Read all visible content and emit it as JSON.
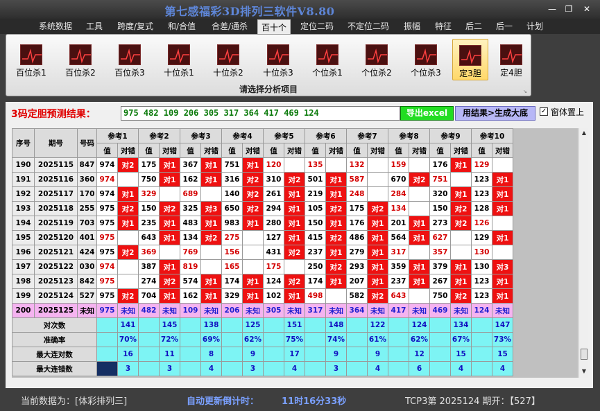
{
  "app": {
    "title": "第七感福彩3D排列三软件V8.80"
  },
  "menu": [
    "系统数据",
    "工具",
    "跨度/复式",
    "和/合值",
    "合差/通杀",
    "百十个",
    "定位二码",
    "不定位二码",
    "振幅",
    "特征",
    "后二",
    "后一",
    "计划"
  ],
  "active_menu": "百十个",
  "ribbon": {
    "buttons": [
      "百位杀1",
      "百位杀2",
      "百位杀3",
      "十位杀1",
      "十位杀2",
      "十位杀3",
      "个位杀1",
      "个位杀2",
      "个位杀3",
      "定3胆",
      "定4胆"
    ],
    "active": "定3胆",
    "caption": "请选择分析项目"
  },
  "result": {
    "label": "3码定胆预测结果：",
    "numbers": "975 482 109 206 305 317 364 417 469 124",
    "excel_label": "导出excel",
    "generate_label": "用结果>生成大底",
    "checkbox_label": "窗体置上",
    "checked": true
  },
  "table": {
    "hdr_seq": "序号",
    "hdr_period": "期号",
    "hdr_code": "号码",
    "refs": [
      "参考1",
      "参考2",
      "参考3",
      "参考4",
      "参考5",
      "参考6",
      "参考7",
      "参考8",
      "参考9",
      "参考10"
    ],
    "sub_val": "值",
    "sub_mark": "对错",
    "rows": [
      {
        "seq": "190",
        "period": "2025115",
        "code": "847",
        "cells": [
          [
            "974",
            "对2"
          ],
          [
            "175",
            "对1"
          ],
          [
            "367",
            "对1"
          ],
          [
            "751",
            "对1"
          ],
          [
            "120",
            ""
          ],
          [
            "135",
            ""
          ],
          [
            "132",
            ""
          ],
          [
            "159",
            ""
          ],
          [
            "176",
            "对1"
          ],
          [
            "129",
            ""
          ]
        ]
      },
      {
        "seq": "191",
        "period": "2025116",
        "code": "360",
        "cells": [
          [
            "974",
            ""
          ],
          [
            "750",
            "对1"
          ],
          [
            "162",
            "对1"
          ],
          [
            "316",
            "对2"
          ],
          [
            "310",
            "对2"
          ],
          [
            "501",
            "对1"
          ],
          [
            "587",
            ""
          ],
          [
            "670",
            "对2"
          ],
          [
            "751",
            ""
          ],
          [
            "123",
            "对1"
          ]
        ]
      },
      {
        "seq": "192",
        "period": "2025117",
        "code": "170",
        "cells": [
          [
            "974",
            "对1"
          ],
          [
            "329",
            ""
          ],
          [
            "689",
            ""
          ],
          [
            "140",
            "对2"
          ],
          [
            "261",
            "对1"
          ],
          [
            "219",
            "对1"
          ],
          [
            "248",
            ""
          ],
          [
            "284",
            ""
          ],
          [
            "320",
            "对1"
          ],
          [
            "123",
            "对1"
          ]
        ]
      },
      {
        "seq": "193",
        "period": "2025118",
        "code": "255",
        "cells": [
          [
            "975",
            "对2"
          ],
          [
            "150",
            "对2"
          ],
          [
            "325",
            "对3"
          ],
          [
            "650",
            "对2"
          ],
          [
            "294",
            "对1"
          ],
          [
            "105",
            "对2"
          ],
          [
            "175",
            "对2"
          ],
          [
            "134",
            ""
          ],
          [
            "150",
            "对2"
          ],
          [
            "128",
            "对1"
          ]
        ]
      },
      {
        "seq": "194",
        "period": "2025119",
        "code": "703",
        "cells": [
          [
            "975",
            "对1"
          ],
          [
            "235",
            "对1"
          ],
          [
            "483",
            "对1"
          ],
          [
            "983",
            "对1"
          ],
          [
            "280",
            "对1"
          ],
          [
            "150",
            "对1"
          ],
          [
            "176",
            "对1"
          ],
          [
            "201",
            "对1"
          ],
          [
            "273",
            "对2"
          ],
          [
            "126",
            ""
          ]
        ]
      },
      {
        "seq": "195",
        "period": "2025120",
        "code": "401",
        "cells": [
          [
            "975",
            ""
          ],
          [
            "643",
            "对1"
          ],
          [
            "134",
            "对2"
          ],
          [
            "275",
            ""
          ],
          [
            "127",
            "对1"
          ],
          [
            "415",
            "对2"
          ],
          [
            "486",
            "对1"
          ],
          [
            "564",
            "对1"
          ],
          [
            "627",
            ""
          ],
          [
            "129",
            "对1"
          ]
        ]
      },
      {
        "seq": "196",
        "period": "2025121",
        "code": "424",
        "cells": [
          [
            "975",
            "对2"
          ],
          [
            "369",
            ""
          ],
          [
            "769",
            ""
          ],
          [
            "156",
            ""
          ],
          [
            "431",
            "对2"
          ],
          [
            "237",
            "对1"
          ],
          [
            "279",
            "对1"
          ],
          [
            "317",
            ""
          ],
          [
            "357",
            ""
          ],
          [
            "130",
            ""
          ]
        ]
      },
      {
        "seq": "197",
        "period": "2025122",
        "code": "030",
        "cells": [
          [
            "974",
            ""
          ],
          [
            "387",
            "对1"
          ],
          [
            "819",
            ""
          ],
          [
            "165",
            ""
          ],
          [
            "175",
            ""
          ],
          [
            "250",
            "对2"
          ],
          [
            "293",
            "对1"
          ],
          [
            "359",
            "对1"
          ],
          [
            "379",
            "对1"
          ],
          [
            "130",
            "对3"
          ]
        ]
      },
      {
        "seq": "198",
        "period": "2025123",
        "code": "842",
        "cells": [
          [
            "975",
            ""
          ],
          [
            "274",
            "对2"
          ],
          [
            "574",
            "对1"
          ],
          [
            "174",
            "对1"
          ],
          [
            "124",
            "对2"
          ],
          [
            "174",
            "对1"
          ],
          [
            "207",
            "对1"
          ],
          [
            "237",
            "对1"
          ],
          [
            "267",
            "对1"
          ],
          [
            "123",
            "对1"
          ]
        ]
      },
      {
        "seq": "199",
        "period": "2025124",
        "code": "527",
        "cells": [
          [
            "975",
            "对2"
          ],
          [
            "704",
            "对1"
          ],
          [
            "162",
            "对1"
          ],
          [
            "329",
            "对1"
          ],
          [
            "102",
            "对1"
          ],
          [
            "498",
            ""
          ],
          [
            "582",
            "对2"
          ],
          [
            "643",
            ""
          ],
          [
            "750",
            "对2"
          ],
          [
            "123",
            "对1"
          ]
        ]
      }
    ],
    "red_values": [
      [
        0,
        4
      ],
      [
        0,
        5
      ],
      [
        0,
        6
      ],
      [
        0,
        7
      ],
      [
        0,
        9
      ],
      [
        1,
        0
      ],
      [
        1,
        6
      ],
      [
        1,
        8
      ],
      [
        2,
        1
      ],
      [
        2,
        2
      ],
      [
        2,
        6
      ],
      [
        2,
        7
      ],
      [
        3,
        7
      ],
      [
        4,
        9
      ],
      [
        5,
        0
      ],
      [
        5,
        3
      ],
      [
        5,
        8
      ],
      [
        6,
        1
      ],
      [
        6,
        2
      ],
      [
        6,
        3
      ],
      [
        6,
        7
      ],
      [
        6,
        8
      ],
      [
        6,
        9
      ],
      [
        7,
        0
      ],
      [
        7,
        2
      ],
      [
        7,
        3
      ],
      [
        7,
        4
      ],
      [
        8,
        0
      ],
      [
        9,
        5
      ],
      [
        9,
        7
      ]
    ],
    "pred": {
      "seq": "200",
      "period": "2025125",
      "code": "未知",
      "vals": [
        "975",
        "482",
        "109",
        "206",
        "305",
        "317",
        "364",
        "417",
        "469",
        "124"
      ],
      "mark": "未知"
    },
    "stats": [
      {
        "label": "对次数",
        "vals": [
          "141",
          "145",
          "138",
          "125",
          "151",
          "148",
          "122",
          "124",
          "134",
          "147"
        ]
      },
      {
        "label": "准确率",
        "vals": [
          "70%",
          "72%",
          "69%",
          "62%",
          "75%",
          "74%",
          "61%",
          "62%",
          "67%",
          "73%"
        ]
      },
      {
        "label": "最大连对数",
        "vals": [
          "16",
          "11",
          "8",
          "9",
          "17",
          "9",
          "9",
          "12",
          "15",
          "15"
        ]
      },
      {
        "label": "最大连错数",
        "vals": [
          "3",
          "3",
          "4",
          "3",
          "4",
          "3",
          "4",
          "6",
          "4",
          "4"
        ]
      }
    ]
  },
  "status": {
    "current_data": "当前数据为：[体彩排列三]",
    "countdown_label": "自动更新倒计时：",
    "countdown": "11时16分33秒",
    "last_draw": "TCP3第 2025124 期开：【527】"
  },
  "colors": {
    "hit": "#ee1111",
    "pred_row": "#f5b3f0",
    "stats": "#7df4f4",
    "blue_text": "#1010c0",
    "red_text": "#d40000",
    "title": "#5e86d8",
    "excel": "#22dd22",
    "generate": "#b7b7f6"
  }
}
